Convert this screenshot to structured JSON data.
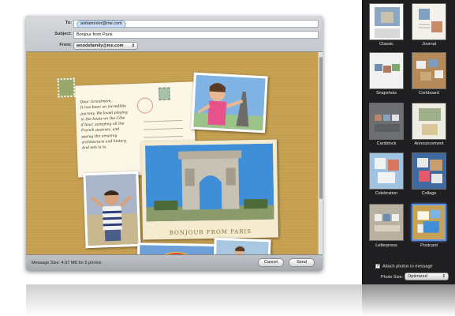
{
  "header": {
    "to_label": "To:",
    "to_value": "anitamerier@me.com",
    "subject_label": "Subject:",
    "subject_value": "Bonjour from Paris",
    "from_label": "From:",
    "from_value": "woodsfamily@me.com"
  },
  "postcard": {
    "lines": [
      "Dear Grandmom,",
      "It has been an incredible",
      "journey. We loved playing",
      "in the boats on the Côte",
      "d'Azur, sampling all the",
      "French pastries, and",
      "seeing the amazing",
      "architecture and history.",
      "And ooh la la."
    ],
    "banner": "BONJOUR FROM PARIS"
  },
  "footer": {
    "message_size": "Message Size:  4.97 MB for 5 photos",
    "cancel_label": "Cancel",
    "send_label": "Send"
  },
  "templates": [
    {
      "label": "Classic",
      "selected": false
    },
    {
      "label": "Journal",
      "selected": false
    },
    {
      "label": "Snapshots",
      "selected": false
    },
    {
      "label": "Corkboard",
      "selected": false
    },
    {
      "label": "Cardstock",
      "selected": false
    },
    {
      "label": "Announcement",
      "selected": false
    },
    {
      "label": "Celebration",
      "selected": false
    },
    {
      "label": "Collage",
      "selected": false
    },
    {
      "label": "Letterpress",
      "selected": false
    },
    {
      "label": "Postcard",
      "selected": true
    }
  ],
  "options": {
    "attach_label": "Attach photos to message",
    "attach_checked": true,
    "photo_size_label": "Photo Size:",
    "photo_size_value": "Optimized"
  },
  "icons": {
    "popup_chevron": "chevron-updown-icon",
    "checkbox": "checkmark-icon"
  },
  "colors": {
    "canvas_bg": "#c8a253",
    "sidebar_bg": "#1f1f21",
    "selection": "#5b8ee6"
  }
}
